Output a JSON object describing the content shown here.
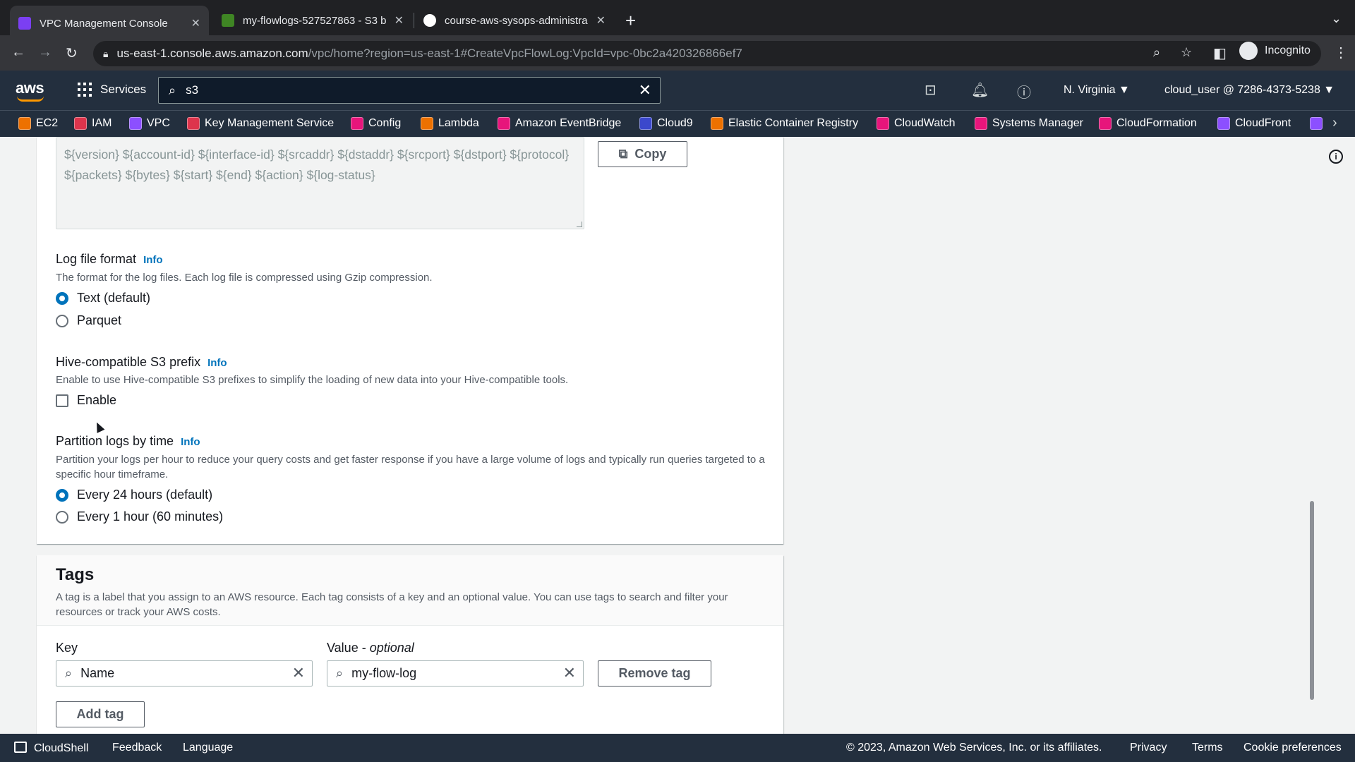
{
  "browser": {
    "tabs": [
      {
        "title": "VPC Management Console",
        "favicon_color": "#7b3ff2"
      },
      {
        "title": "my-flowlogs-527527863 - S3 b",
        "favicon_color": "#3f8624"
      },
      {
        "title": "course-aws-sysops-administra",
        "favicon_color": "#ffffff"
      }
    ],
    "url_host": "us-east-1.console.aws.amazon.com",
    "url_rest": "/vpc/home?region=us-east-1#CreateVpcFlowLog:VpcId=vpc-0bc2a420326866ef7",
    "profile_label": "Incognito"
  },
  "aws_header": {
    "logo": "aws",
    "services_label": "Services",
    "search_value": "s3",
    "region": "N. Virginia ▼",
    "user": "cloud_user @ 7286-4373-5238 ▼"
  },
  "favorites": [
    {
      "label": "EC2",
      "color": "#ed7100"
    },
    {
      "label": "IAM",
      "color": "#dd344c"
    },
    {
      "label": "VPC",
      "color": "#8c4fff"
    },
    {
      "label": "Key Management Service",
      "color": "#dd344c"
    },
    {
      "label": "Config",
      "color": "#e7157b"
    },
    {
      "label": "Lambda",
      "color": "#ed7100"
    },
    {
      "label": "Amazon EventBridge",
      "color": "#e7157b"
    },
    {
      "label": "Cloud9",
      "color": "#3b48cc"
    },
    {
      "label": "Elastic Container Registry",
      "color": "#ed7100"
    },
    {
      "label": "CloudWatch",
      "color": "#e7157b"
    },
    {
      "label": "Systems Manager",
      "color": "#e7157b"
    },
    {
      "label": "CloudFormation",
      "color": "#e7157b"
    },
    {
      "label": "CloudFront",
      "color": "#8c4fff"
    }
  ],
  "form": {
    "format_preview": "${version} ${account-id} ${interface-id} ${srcaddr} ${dstaddr} ${srcport} ${dstport} ${protocol} ${packets} ${bytes} ${start} ${end} ${action} ${log-status}",
    "copy_label": "Copy",
    "log_file_format": {
      "label": "Log file format",
      "info": "Info",
      "description": "The format for the log files. Each log file is compressed using Gzip compression.",
      "options": [
        "Text (default)",
        "Parquet"
      ],
      "selected": "Text (default)"
    },
    "hive_prefix": {
      "label": "Hive-compatible S3 prefix",
      "info": "Info",
      "description": "Enable to use Hive-compatible S3 prefixes to simplify the loading of new data into your Hive-compatible tools.",
      "checkbox_label": "Enable",
      "checked": false
    },
    "partition": {
      "label": "Partition logs by time",
      "info": "Info",
      "description": "Partition your logs per hour to reduce your query costs and get faster response if you have a large volume of logs and typically run queries targeted to a specific hour timeframe.",
      "options": [
        "Every 24 hours (default)",
        "Every 1 hour (60 minutes)"
      ],
      "selected": "Every 24 hours (default)"
    }
  },
  "tags": {
    "title": "Tags",
    "description": "A tag is a label that you assign to an AWS resource. Each tag consists of a key and an optional value. You can use tags to search and filter your resources or track your AWS costs.",
    "key_label": "Key",
    "value_label": "Value - ",
    "value_optional": "optional",
    "key_value": "Name",
    "value_value": "my-flow-log",
    "remove_label": "Remove tag",
    "add_label": "Add tag"
  },
  "footer": {
    "cloudshell": "CloudShell",
    "feedback": "Feedback",
    "language": "Language",
    "copyright": "© 2023, Amazon Web Services, Inc. or its affiliates.",
    "privacy": "Privacy",
    "terms": "Terms",
    "cookies": "Cookie preferences"
  }
}
